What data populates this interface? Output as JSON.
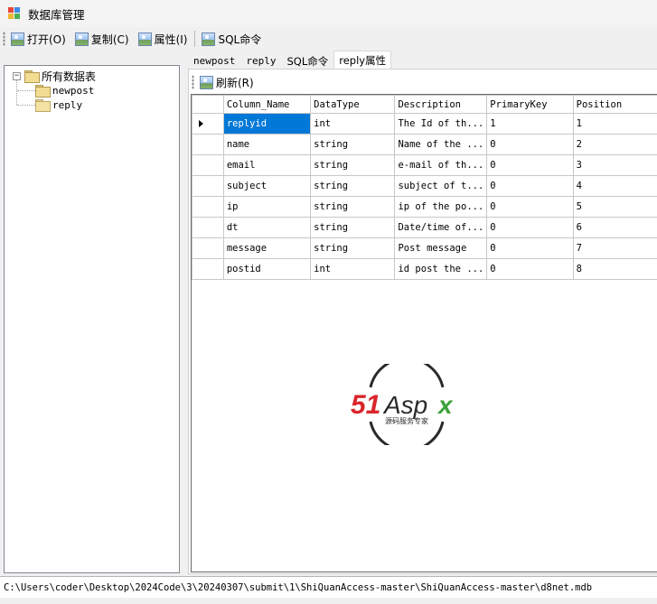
{
  "window": {
    "title": "数据库管理"
  },
  "toolbar": {
    "open_label": "打开(O)",
    "copy_label": "复制(C)",
    "properties_label": "属性(I)",
    "sql_label": "SQL命令"
  },
  "tree": {
    "root_label": "所有数据表",
    "items": [
      "newpost",
      "reply"
    ]
  },
  "tabs": [
    "newpost",
    "reply",
    "SQL命令",
    "reply属性"
  ],
  "active_tab": "reply属性",
  "inner_toolbar": {
    "refresh_label": "刷新(R)"
  },
  "grid": {
    "columns": [
      "Column_Name",
      "DataType",
      "Description",
      "PrimaryKey",
      "Position"
    ],
    "rows": [
      [
        "replyid",
        "int",
        "The Id of th...",
        "1",
        "1"
      ],
      [
        "name",
        "string",
        "Name of the ...",
        "0",
        "2"
      ],
      [
        "email",
        "string",
        "e-mail of th...",
        "0",
        "3"
      ],
      [
        "subject",
        "string",
        "subject of t...",
        "0",
        "4"
      ],
      [
        "ip",
        "string",
        "ip of the po...",
        "0",
        "5"
      ],
      [
        "dt",
        "string",
        "Date/time of...",
        "0",
        "6"
      ],
      [
        "message",
        "string",
        "Post message",
        "0",
        "7"
      ],
      [
        "postid",
        "int",
        "id post the ...",
        "0",
        "8"
      ]
    ],
    "selected_row": 0
  },
  "watermark": {
    "brand": "51Aspx",
    "tagline": "源码服务专家"
  },
  "status": {
    "path": "C:\\Users\\coder\\Desktop\\2024Code\\3\\20240307\\submit\\1\\ShiQuanAccess-master\\ShiQuanAccess-master\\d8net.mdb"
  },
  "colors": {
    "selection": "#0078d7",
    "logo_red": "#d9262a",
    "logo_green": "#3da03a"
  },
  "icons": {
    "app": "app-windows-icon",
    "open": "picture-icon",
    "copy": "picture-icon",
    "properties": "picture-icon",
    "sql": "picture-icon",
    "refresh": "picture-icon",
    "folder": "folder-icon",
    "open_folder": "open-folder-icon"
  }
}
